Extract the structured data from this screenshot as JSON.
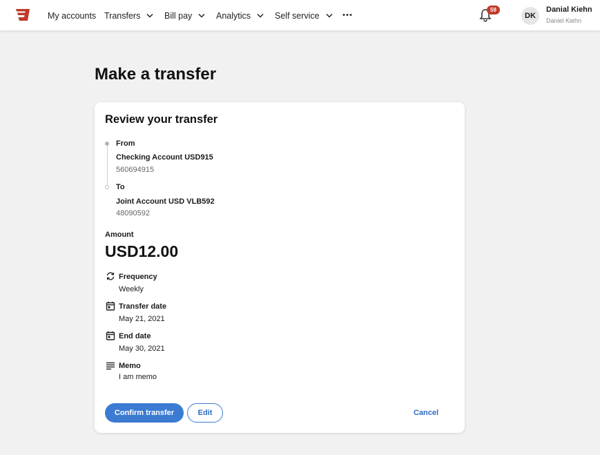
{
  "nav": {
    "items": [
      {
        "label": "My accounts"
      },
      {
        "label": "Transfers"
      },
      {
        "label": "Bill pay"
      },
      {
        "label": "Analytics"
      },
      {
        "label": "Self service"
      }
    ],
    "notification_count": "59",
    "user": {
      "initials": "DK",
      "name": "Danial Kiehn",
      "subname": "Daniel Kiehn"
    },
    "brand_color": "#c0392b"
  },
  "page": {
    "title": "Make a transfer"
  },
  "review": {
    "title": "Review your transfer",
    "from": {
      "label": "From",
      "account_name": "Checking Account USD915",
      "account_number": "560694915"
    },
    "to": {
      "label": "To",
      "account_name": "Joint Account USD VLB592",
      "account_number": "48090592"
    },
    "amount": {
      "label": "Amount",
      "value": "USD12.00"
    },
    "frequency": {
      "label": "Frequency",
      "value": "Weekly",
      "icon": "repeat-icon"
    },
    "transfer_date": {
      "label": "Transfer date",
      "value": "May 21, 2021",
      "icon": "calendar-icon"
    },
    "end_date": {
      "label": "End date",
      "value": "May 30, 2021",
      "icon": "calendar-icon"
    },
    "memo": {
      "label": "Memo",
      "value": "I am memo",
      "icon": "notes-icon"
    }
  },
  "actions": {
    "confirm": "Confirm transfer",
    "edit": "Edit",
    "cancel": "Cancel"
  },
  "colors": {
    "primary": "#3b7bd2",
    "badge": "#c0392b"
  }
}
